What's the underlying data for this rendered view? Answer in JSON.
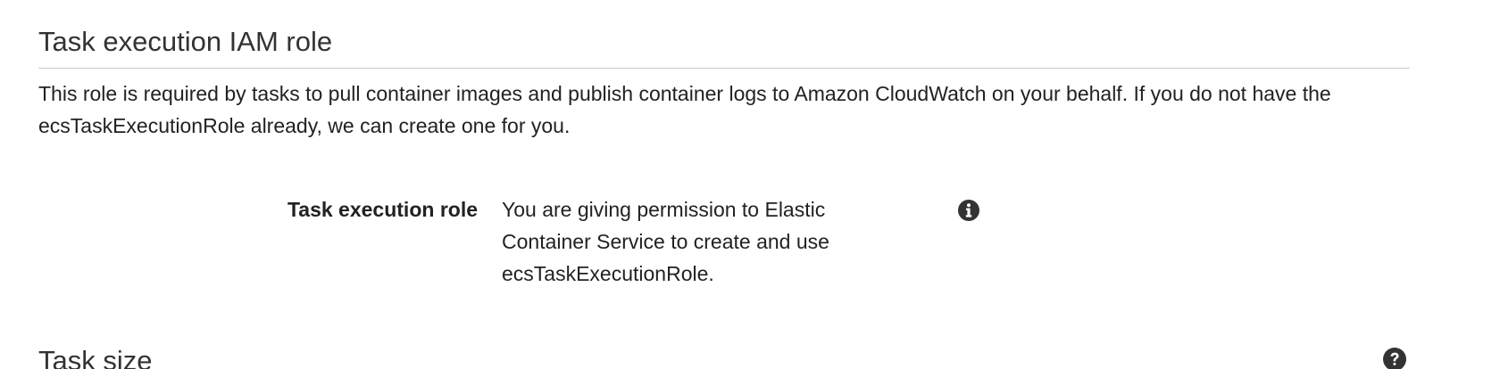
{
  "execution_section": {
    "title": "Task execution IAM role",
    "description": "This role is required by tasks to pull container images and publish container logs to Amazon CloudWatch on your behalf. If you do not have the ecsTaskExecutionRole already, we can create one for you.",
    "field": {
      "label": "Task execution role",
      "value": "You are giving permission to Elastic Container Service to create and use ecsTaskExecutionRole.",
      "icon": "info-circle-icon"
    }
  },
  "size_section": {
    "title": "Task size",
    "icon": "question-circle-icon"
  }
}
